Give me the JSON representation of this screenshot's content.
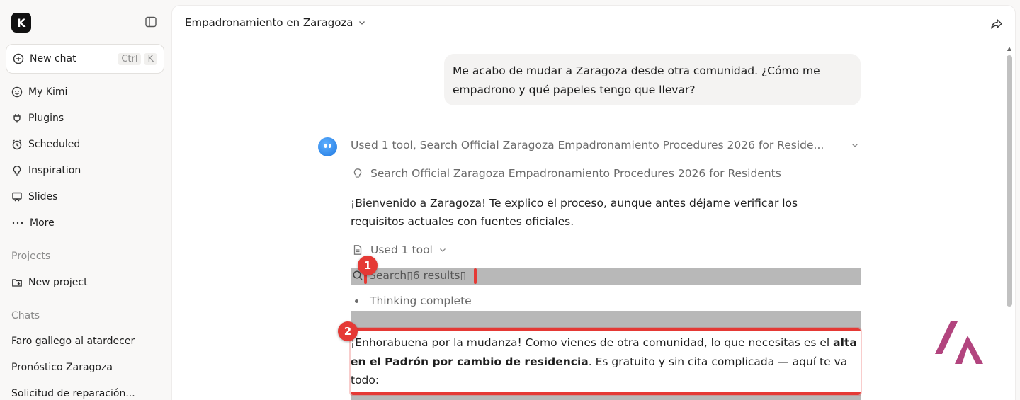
{
  "sidebar": {
    "logo_letter": "K",
    "new_chat": {
      "label": "New chat",
      "shortcut_ctrl": "Ctrl",
      "shortcut_key": "K"
    },
    "nav": [
      {
        "label": "My Kimi",
        "icon": "smile-icon"
      },
      {
        "label": "Plugins",
        "icon": "plug-icon"
      },
      {
        "label": "Scheduled",
        "icon": "alarm-icon"
      },
      {
        "label": "Inspiration",
        "icon": "bulb-icon"
      },
      {
        "label": "Slides",
        "icon": "presentation-icon"
      },
      {
        "label": "More",
        "icon": "more-icon"
      }
    ],
    "projects_label": "Projects",
    "new_project_label": "New project",
    "chats_label": "Chats",
    "chats": [
      "Faro gallego al atardecer",
      "Pronóstico Zaragoza",
      "Solicitud de reparación..."
    ]
  },
  "header": {
    "title": "Empadronamiento en Zaragoza"
  },
  "conversation": {
    "user_message": "Me acabo de mudar a Zaragoza desde otra comunidad. ¿Cómo me empadrono y qué papeles tengo que llevar?",
    "tool_summary": "Used 1 tool, Search Official Zaragoza Empadronamiento Procedures 2026 for Reside...",
    "tool_search_text": "Search Official Zaragoza Empadronamiento Procedures 2026 for Residents",
    "para1": "¡Bienvenido a Zaragoza! Te explico el proceso, aunque antes déjame verificar los requisitos actuales con fuentes oficiales.",
    "used_tool_2": "Used 1 tool",
    "search_results": "Search▯6 results▯",
    "thinking": "Thinking complete",
    "para2_start": "¡Enhorabuena por la mudanza! Como vienes de otra comunidad, lo que necesitas es el",
    "para2_bold": "alta en el Padrón por cambio de residencia",
    "para2_end": ". Es gratuito y sin cita complicada — aquí te va todo:"
  },
  "annotations": {
    "badge1": "1",
    "badge2": "2"
  },
  "colors": {
    "accent_red": "#e53935",
    "watermark": "#b2447e"
  }
}
